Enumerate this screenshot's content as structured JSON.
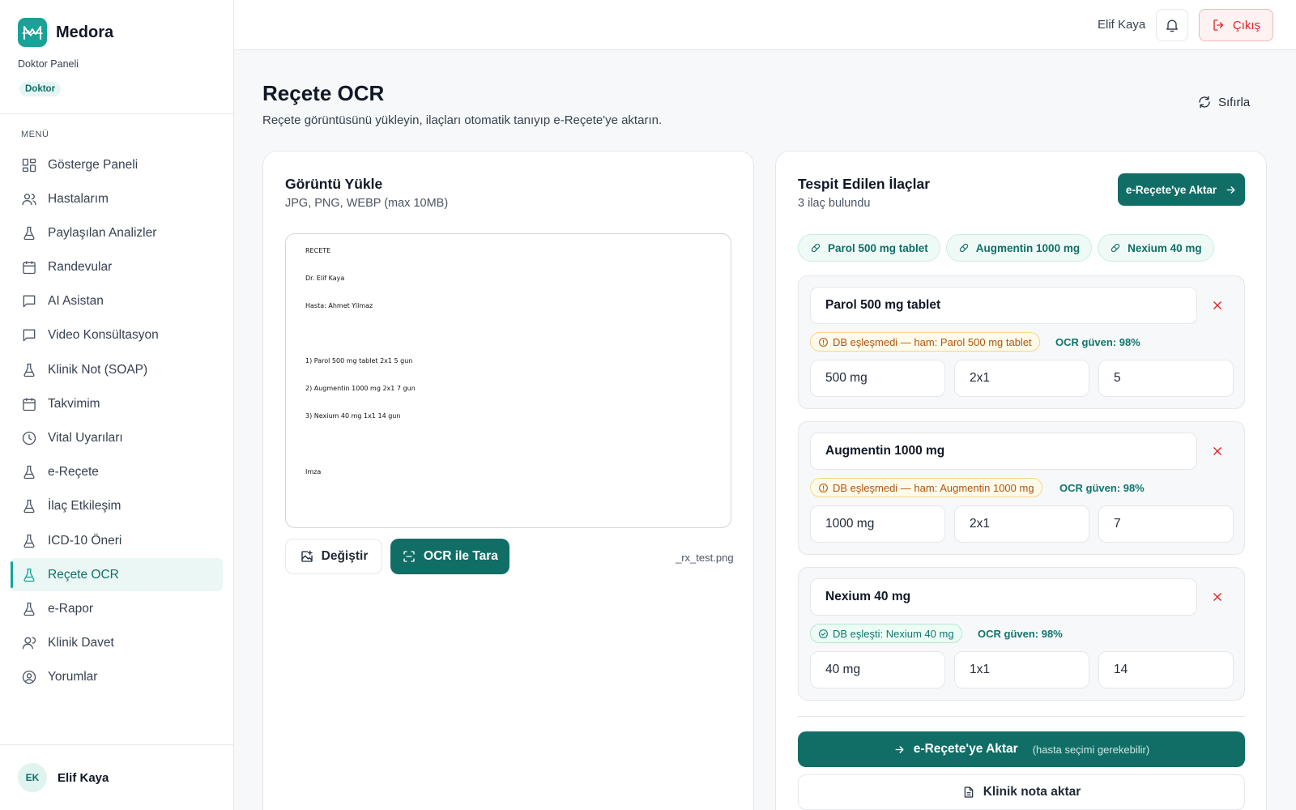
{
  "brand": {
    "name": "Medora",
    "panel": "Doktor Paneli",
    "role": "Doktor"
  },
  "sidebar": {
    "menu_label": "MENÜ",
    "items": [
      {
        "label": "Gösterge Paneli",
        "icon": "grid-icon"
      },
      {
        "label": "Hastalarım",
        "icon": "users-icon"
      },
      {
        "label": "Paylaşılan Analizler",
        "icon": "flask-icon"
      },
      {
        "label": "Randevular",
        "icon": "calendar-icon"
      },
      {
        "label": "AI Asistan",
        "icon": "chat-icon"
      },
      {
        "label": "Video Konsültasyon",
        "icon": "chat-icon"
      },
      {
        "label": "Klinik Not (SOAP)",
        "icon": "flask-icon"
      },
      {
        "label": "Takvimim",
        "icon": "calendar-icon"
      },
      {
        "label": "Vital Uyarıları",
        "icon": "clock-icon"
      },
      {
        "label": "e-Reçete",
        "icon": "flask-icon"
      },
      {
        "label": "İlaç Etkileşim",
        "icon": "flask-icon"
      },
      {
        "label": "ICD-10 Öneri",
        "icon": "flask-icon"
      },
      {
        "label": "Reçete OCR",
        "icon": "flask-icon",
        "active": true
      },
      {
        "label": "e-Rapor",
        "icon": "flask-icon"
      },
      {
        "label": "Klinik Davet",
        "icon": "user-plus-icon"
      },
      {
        "label": "Yorumlar",
        "icon": "user-circle-icon"
      }
    ],
    "user": {
      "initials": "EK",
      "name": "Elif Kaya"
    }
  },
  "topbar": {
    "user_name": "Elif Kaya",
    "logout_label": "Çıkış"
  },
  "page": {
    "title": "Reçete OCR",
    "subtitle": "Reçete görüntüsünü yükleyin, ilaçları otomatik tanıyıp e-Reçete'ye aktarın.",
    "reset_label": "Sıfırla"
  },
  "upload": {
    "title": "Görüntü Yükle",
    "subtitle": "JPG, PNG, WEBP (max 10MB)",
    "preview_lines": {
      "l1": "RECETE",
      "l2": "Dr. Elif Kaya",
      "l3": "Hasta: Ahmet Yilmaz",
      "l4": "1) Parol 500 mg tablet 2x1 5 gun",
      "l5": "2) Augmentin 1000 mg 2x1 7 gun",
      "l6": "3) Nexium 40 mg 1x1 14 gun",
      "l7": "Imza"
    },
    "change_label": "Değiştir",
    "scan_label": "OCR ile Tara",
    "filename": "_rx_test.png"
  },
  "detected": {
    "title": "Tespit Edilen İlaçlar",
    "count_text": "3 ilaç bulundu",
    "export_top_label": "e-Reçete'ye Aktar",
    "chips": [
      "Parol 500 mg tablet",
      "Augmentin 1000 mg",
      "Nexium 40 mg"
    ],
    "meds": [
      {
        "name": "Parol 500 mg tablet",
        "status": "DB eşleşmedi — ham: Parol 500 mg tablet",
        "status_type": "warn",
        "confidence": "OCR güven: 98%",
        "dose": "500 mg",
        "frequency": "2x1",
        "days": "5"
      },
      {
        "name": "Augmentin 1000 mg",
        "status": "DB eşleşmedi — ham: Augmentin 1000 mg",
        "status_type": "warn",
        "confidence": "OCR güven: 98%",
        "dose": "1000 mg",
        "frequency": "2x1",
        "days": "7"
      },
      {
        "name": "Nexium 40 mg",
        "status": "DB eşleşti: Nexium 40 mg",
        "status_type": "ok",
        "confidence": "OCR güven: 98%",
        "dose": "40 mg",
        "frequency": "1x1",
        "days": "14"
      }
    ],
    "export_main_label": "e-Reçete'ye Aktar",
    "export_hint": "(hasta seçimi gerekebilir)",
    "clinical_label": "Klinik nota aktar"
  },
  "colors": {
    "accent": "#17a398",
    "primary_dark": "#116e66",
    "danger": "#dc2626",
    "warn": "#b45309"
  }
}
